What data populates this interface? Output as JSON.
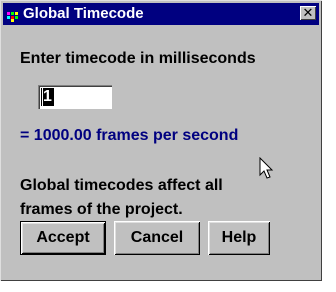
{
  "window": {
    "title": "Global Timecode",
    "close_symbol": "✕"
  },
  "prompt": "Enter timecode in milliseconds",
  "timecode_input": {
    "value": "1"
  },
  "frame_rate": "= 1000.00 frames per second",
  "note": {
    "line1": "Global timecodes affect all",
    "line2": "frames of the project."
  },
  "buttons": {
    "accept": "Accept",
    "cancel": "Cancel",
    "help": "Help"
  },
  "colors": {
    "titlebar": "#000080",
    "dialog": "#c0c0c0",
    "rate_text": "#000080"
  },
  "icons": {
    "title": "app-icon",
    "cursor": "mouse-pointer-icon"
  }
}
